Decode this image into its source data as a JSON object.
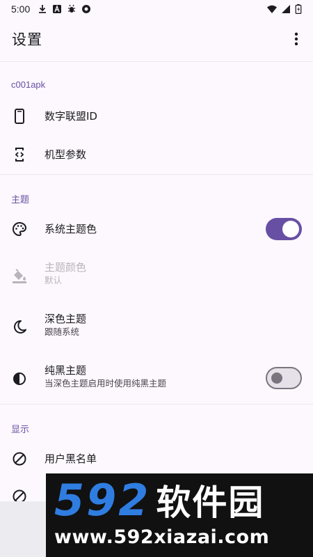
{
  "status_bar": {
    "time": "5:00",
    "left_icons": [
      "download-icon",
      "a-box-icon",
      "bug-icon",
      "record-icon"
    ],
    "right_icons": [
      "wifi-icon",
      "signal-icon",
      "battery-icon"
    ]
  },
  "app_bar": {
    "title": "设置",
    "more_icon": "more-vertical-icon"
  },
  "sections": {
    "c001apk": {
      "header": "c001apk",
      "items": [
        {
          "title": "数字联盟ID",
          "icon": "phone-icon"
        },
        {
          "title": "机型参数",
          "icon": "device-code-icon"
        }
      ]
    },
    "theme": {
      "header": "主题",
      "items": [
        {
          "title": "系统主题色",
          "icon": "palette-icon",
          "switch": true
        },
        {
          "title": "主题颜色",
          "summary": "默认",
          "icon": "paint-bucket-icon",
          "enabled": false
        },
        {
          "title": "深色主题",
          "summary": "跟随系统",
          "icon": "moon-icon"
        },
        {
          "title": "纯黑主题",
          "summary": "当深色主题启用时使用纯黑主题",
          "icon": "contrast-icon",
          "switch": false
        }
      ]
    },
    "display": {
      "header": "显示",
      "items": [
        {
          "title": "用户黑名单",
          "icon": "block-icon"
        },
        {
          "title": "",
          "icon": "block-icon"
        }
      ]
    }
  },
  "watermark": {
    "digits": "592",
    "name": "软件园",
    "url": "www.592xiazai.com"
  },
  "colors": {
    "accent": "#6750a4",
    "background": "#fdf8fd",
    "watermark_blue": "#2f7de1"
  }
}
